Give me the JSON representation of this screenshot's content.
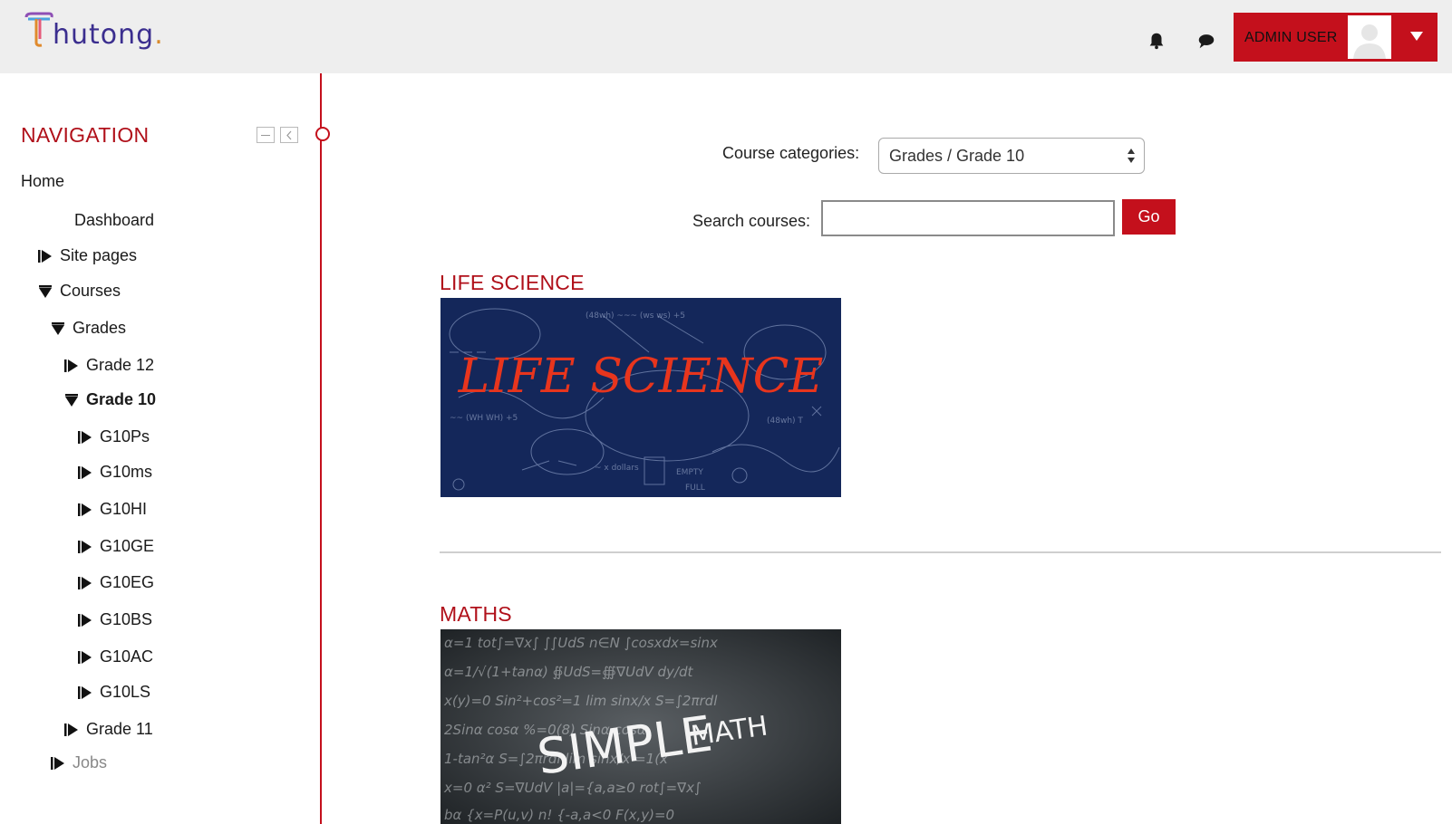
{
  "header": {
    "logo_text": "hutong",
    "logo_dot": ".",
    "user_name": "ADMIN USER"
  },
  "icons": {
    "notifications": "bell-icon",
    "messages": "chat-bubble-icon",
    "user_menu": "caret-down-icon"
  },
  "colors": {
    "accent": "#c4101c",
    "header_bg": "#eeeeee",
    "title": "#b0101a"
  },
  "sidebar": {
    "title": "NAVIGATION",
    "items": [
      {
        "label": "Home",
        "state": "none"
      },
      {
        "label": "Dashboard",
        "state": "none"
      },
      {
        "label": "Site pages",
        "state": "collapsed"
      },
      {
        "label": "Courses",
        "state": "expanded"
      },
      {
        "label": "Grades",
        "state": "expanded"
      },
      {
        "label": "Grade 12",
        "state": "collapsed"
      },
      {
        "label": "Grade 10",
        "state": "expanded",
        "current": true
      },
      {
        "label": "G10Ps",
        "state": "collapsed"
      },
      {
        "label": "G10ms",
        "state": "collapsed"
      },
      {
        "label": "G10HI",
        "state": "collapsed"
      },
      {
        "label": "G10GE",
        "state": "collapsed"
      },
      {
        "label": "G10EG",
        "state": "collapsed"
      },
      {
        "label": "G10BS",
        "state": "collapsed"
      },
      {
        "label": "G10AC",
        "state": "collapsed"
      },
      {
        "label": "G10LS",
        "state": "collapsed"
      },
      {
        "label": "Grade 11",
        "state": "collapsed"
      },
      {
        "label": "Jobs",
        "state": "collapsed"
      }
    ]
  },
  "main": {
    "category_label": "Course categories:",
    "category_selected": "Grades / Grade 10",
    "search_label": "Search courses:",
    "search_value": "",
    "go_label": "Go",
    "courses": [
      {
        "title": "LIFE SCIENCE",
        "image_text": "LIFE SCIENCE"
      },
      {
        "title": "MATHS",
        "image_text_1": "SIMPLE",
        "image_text_2": "MATH"
      }
    ]
  }
}
